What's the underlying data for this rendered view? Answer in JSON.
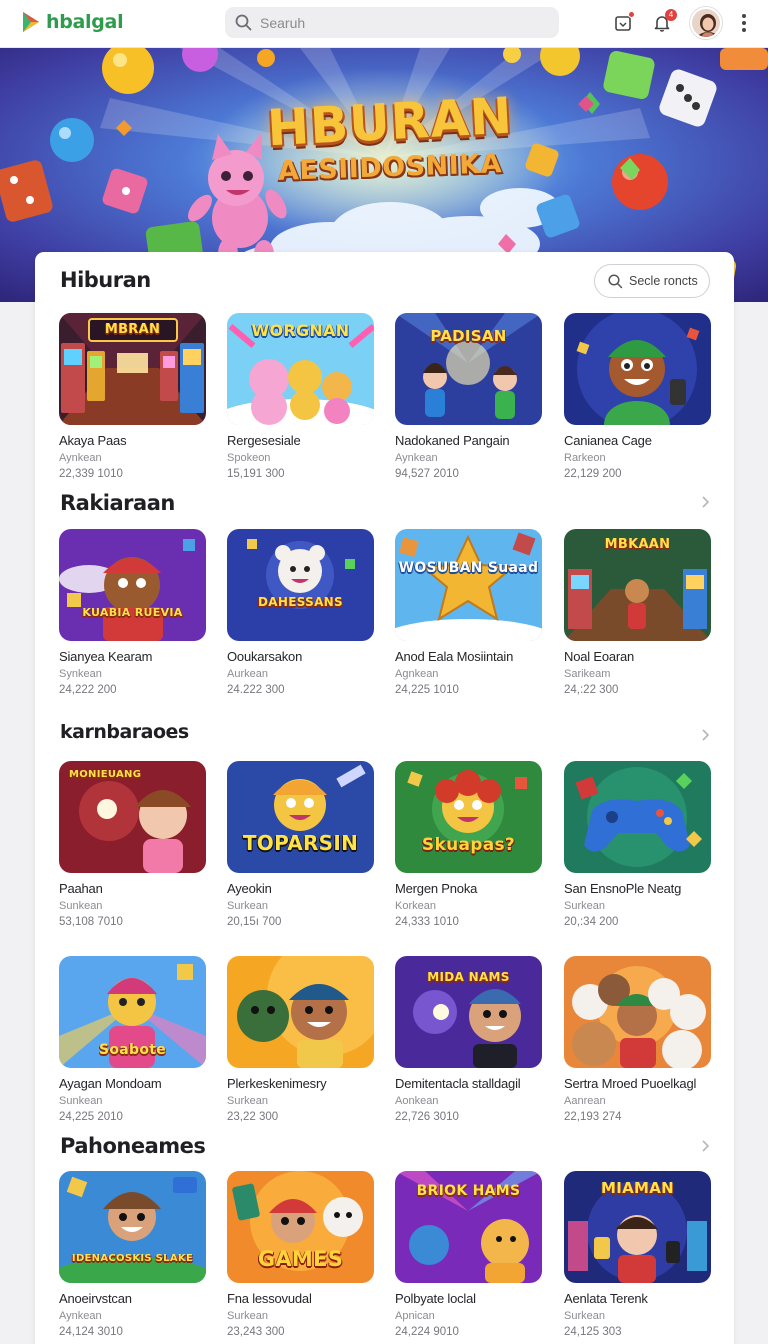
{
  "header": {
    "logo_text": "hbalgal",
    "search_placeholder": "Searuh",
    "notifications_count": "4",
    "brand_color": "#2f9b4d"
  },
  "hero": {
    "title_line1": "HBURAN",
    "title_line2": "AESIIDOSNIKA"
  },
  "sections": [
    {
      "title": "Hiburan",
      "see_more_label": "Secle roncts",
      "items": [
        {
          "name": "Akaya Paas",
          "category": "Aynkean",
          "count": "22,339 1010",
          "thumb_text": "MBRAN"
        },
        {
          "name": "Rergesesiale",
          "category": "Spokeon",
          "count": "15,191 300",
          "thumb_text": "WORGNAN"
        },
        {
          "name": "Nadokaned Pangain",
          "category": "Aynkean",
          "count": "94,527 2010",
          "thumb_text": "PADISAN"
        },
        {
          "name": "Canianea Cage",
          "category": "Rarkeon",
          "count": "22,129 200",
          "thumb_text": ""
        }
      ]
    },
    {
      "title": "Rakiaraan",
      "items": [
        {
          "name": "Sianyea Kearam",
          "category": "Synkean",
          "count": "24,222 200",
          "thumb_text": "KUABIA RUEVIA"
        },
        {
          "name": "Ooukarsakon",
          "category": "Aurkean",
          "count": "24.222 300",
          "thumb_text": "DAHESSANS"
        },
        {
          "name": "Anod Eala Mosiintain",
          "category": "Agnkean",
          "count": "24,225 1010",
          "thumb_text": "WOSUBAN Suaad"
        },
        {
          "name": "Noal Eoaran",
          "category": "Sarikeam",
          "count": "24,:22 300",
          "thumb_text": "MBKAAN"
        }
      ]
    },
    {
      "title": "karnbaraoes",
      "items": [
        {
          "name": "Paahan",
          "category": "Sunkean",
          "count": "53,108 7010",
          "thumb_text": "MONIEUANG"
        },
        {
          "name": "Ayeokin",
          "category": "Surkean",
          "count": "20,15ı 700",
          "thumb_text": "TOPARSIN"
        },
        {
          "name": "Mergen Pnoka",
          "category": "Korkean",
          "count": "24,333 1010",
          "thumb_text": "Skuapas?"
        },
        {
          "name": "San EnsnoPle Neatg",
          "category": "Surkean",
          "count": "20,:34 200",
          "thumb_text": ""
        }
      ]
    },
    {
      "title": "",
      "items": [
        {
          "name": "Ayagan Mondoam",
          "category": "Sunkean",
          "count": "24,225 2010",
          "thumb_text": "Soabote"
        },
        {
          "name": "Plerkeskenimesry",
          "category": "Surkean",
          "count": "23,22 300",
          "thumb_text": ""
        },
        {
          "name": "Demitentacla stalldagil",
          "category": "Aonkean",
          "count": "22,726 3010",
          "thumb_text": "MIDA NAMS"
        },
        {
          "name": "Sertra Mroed Puoelkagl",
          "category": "Aanrean",
          "count": "22,193 274",
          "thumb_text": ""
        }
      ]
    },
    {
      "title": "Pahoneames",
      "items": [
        {
          "name": "Anoeirvstcan",
          "category": "Aynkean",
          "count": "24,124 3010",
          "thumb_text": "IDENACOSKIS SLAKE"
        },
        {
          "name": "Fna lessovudal",
          "category": "Surkean",
          "count": "23,243 300",
          "thumb_text": "GAMES"
        },
        {
          "name": "Polbyate loclal",
          "category": "Apnican",
          "count": "24,224 9010",
          "thumb_text": "BRIOK HAMS"
        },
        {
          "name": "Aenlata Terenk",
          "category": "Surkean",
          "count": "24,125 303",
          "thumb_text": "MIAMAN"
        }
      ]
    }
  ]
}
